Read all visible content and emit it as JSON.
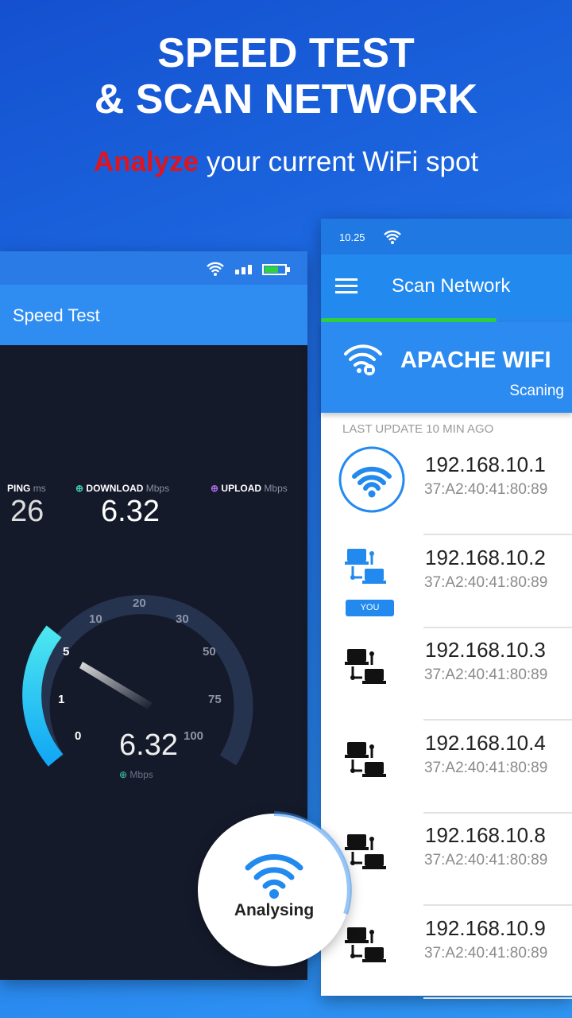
{
  "headline": {
    "line1": "SPEED TEST",
    "line2": "& SCAN NETWORK",
    "highlight": "Analyze",
    "rest": " your current WiFi spot"
  },
  "speed_test": {
    "title": "Speed Test",
    "ping_label": "PING",
    "ping_unit": "ms",
    "ping_value": "26",
    "download_label": "DOWNLOAD",
    "download_unit": "Mbps",
    "download_value": "6.32",
    "upload_label": "UPLOAD",
    "upload_unit": "Mbps",
    "gauge": {
      "ticks": [
        "0",
        "1",
        "5",
        "10",
        "20",
        "30",
        "50",
        "75",
        "100"
      ],
      "value": "6.32",
      "unit": "Mbps",
      "accent": "#28c8f5"
    }
  },
  "scan": {
    "time": "10.25",
    "title": "Scan Network",
    "progress": 0.7,
    "network_name": "APACHE WIFI",
    "status": "Scaning",
    "last_update": "LAST UPDATE 10 MIN AGO",
    "devices": [
      {
        "ip": "192.168.10.1",
        "mac": "37:A2:40:41:80:89",
        "icon": "router-wifi-icon"
      },
      {
        "ip": "192.168.10.2",
        "mac": "37:A2:40:41:80:89",
        "icon": "network-device-icon",
        "badge": "YOU"
      },
      {
        "ip": "192.168.10.3",
        "mac": "37:A2:40:41:80:89",
        "icon": "network-device-icon"
      },
      {
        "ip": "192.168.10.4",
        "mac": "37:A2:40:41:80:89",
        "icon": "network-device-icon"
      },
      {
        "ip": "192.168.10.8",
        "mac": "37:A2:40:41:80:89",
        "icon": "network-device-icon"
      },
      {
        "ip": "192.168.10.9",
        "mac": "37:A2:40:41:80:89",
        "icon": "network-device-icon"
      }
    ]
  },
  "analysing": {
    "label": "Analysing"
  },
  "colors": {
    "primary": "#2289ef",
    "progress": "#2fcf3d",
    "highlight": "#e0141e",
    "dark_bg": "#151a2b"
  }
}
